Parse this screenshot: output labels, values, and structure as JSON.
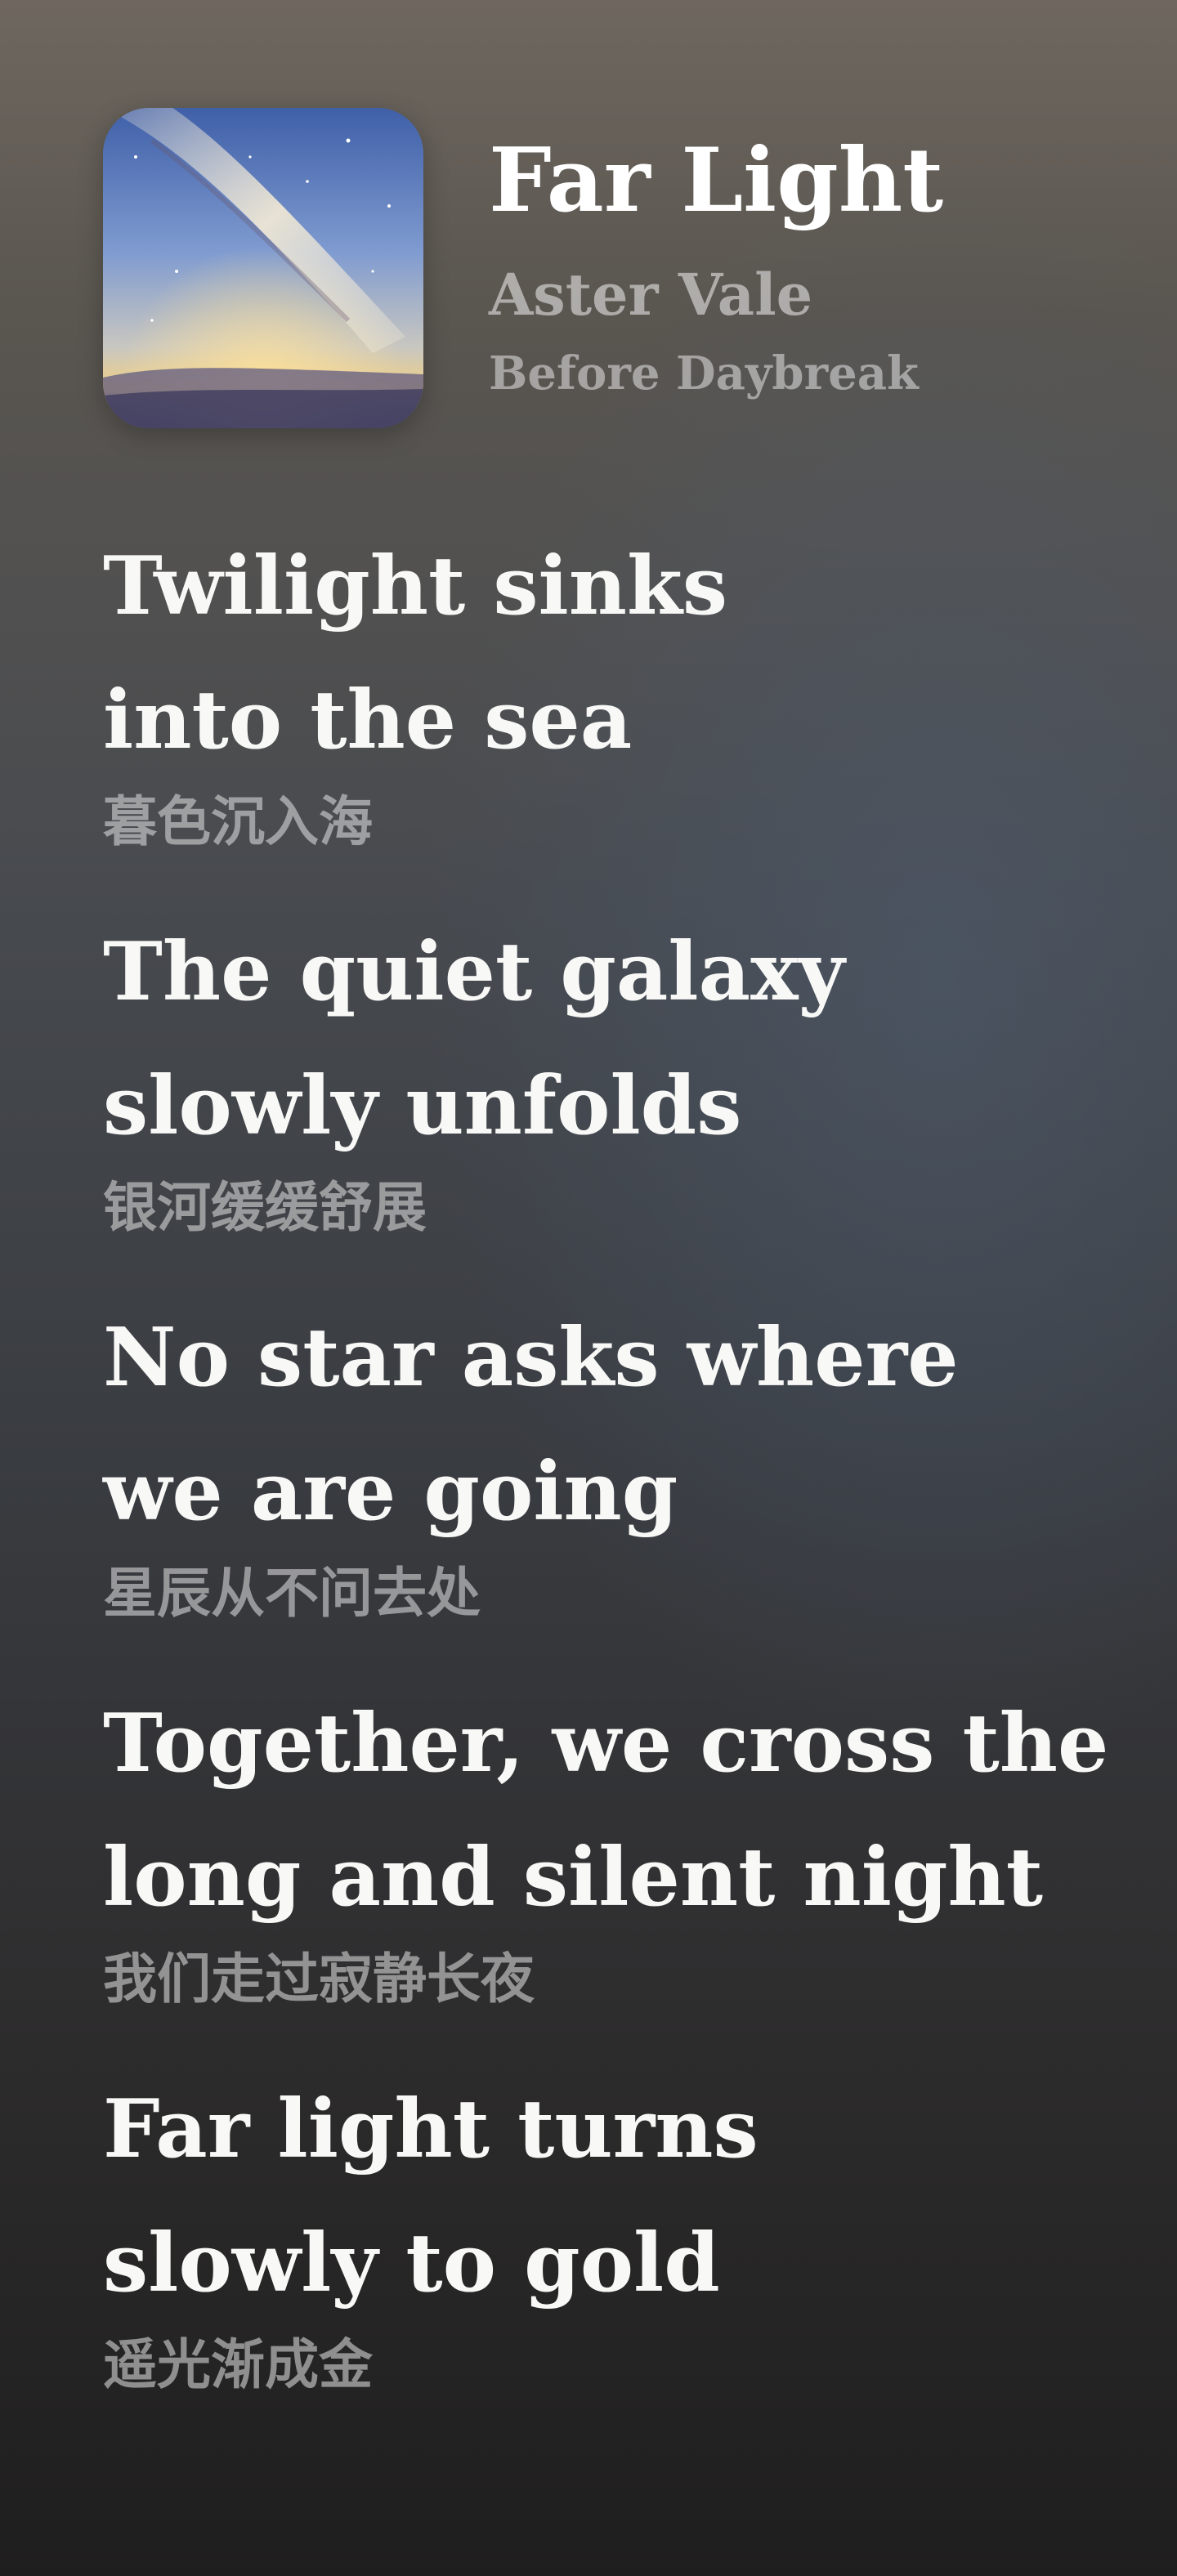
{
  "track": {
    "title": "Far Light",
    "artist": "Aster Vale",
    "album": "Before Daybreak"
  },
  "lyrics": [
    {
      "lines": [
        "Twilight sinks",
        "into the sea"
      ],
      "translation": "暮色沉入海"
    },
    {
      "lines": [
        "The quiet galaxy",
        "slowly unfolds"
      ],
      "translation": "银河缓缓舒展"
    },
    {
      "lines": [
        "No star asks where",
        "we are going"
      ],
      "translation": "星辰从不问去处"
    },
    {
      "lines": [
        "Together, we cross the",
        "long and silent night"
      ],
      "translation": "我们走过寂静长夜"
    },
    {
      "lines": [
        "Far light turns",
        "slowly to gold"
      ],
      "translation": "遥光渐成金"
    }
  ]
}
